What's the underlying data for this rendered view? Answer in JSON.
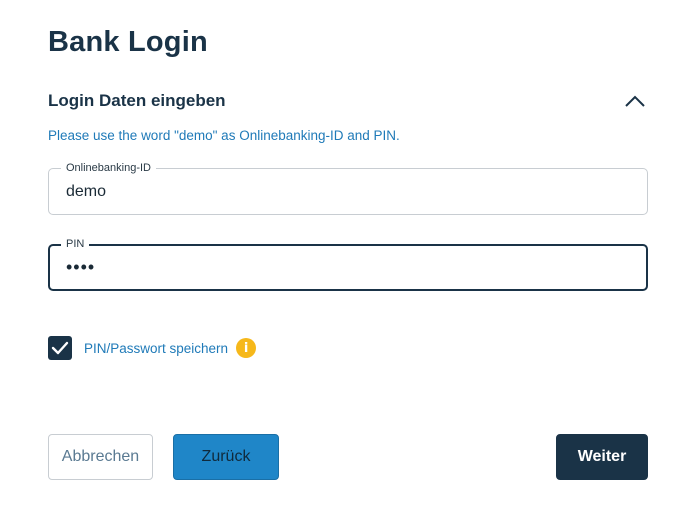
{
  "page": {
    "title": "Bank Login"
  },
  "section": {
    "title": "Login Daten eingeben",
    "hint": "Please use the word \"demo\" as Onlinebanking-ID and PIN."
  },
  "fields": {
    "id": {
      "label": "Onlinebanking-ID",
      "value": "demo"
    },
    "pin": {
      "label": "PIN",
      "value": "••••"
    }
  },
  "remember": {
    "label": "PIN/Passwort speichern",
    "checked": true,
    "info_icon": "i"
  },
  "buttons": {
    "cancel": "Abbrechen",
    "back": "Zurück",
    "next": "Weiter"
  },
  "colors": {
    "primary": "#1a3347",
    "link": "#1f7ab8",
    "accent_blue": "#1f86c8",
    "info": "#f6b81a"
  }
}
